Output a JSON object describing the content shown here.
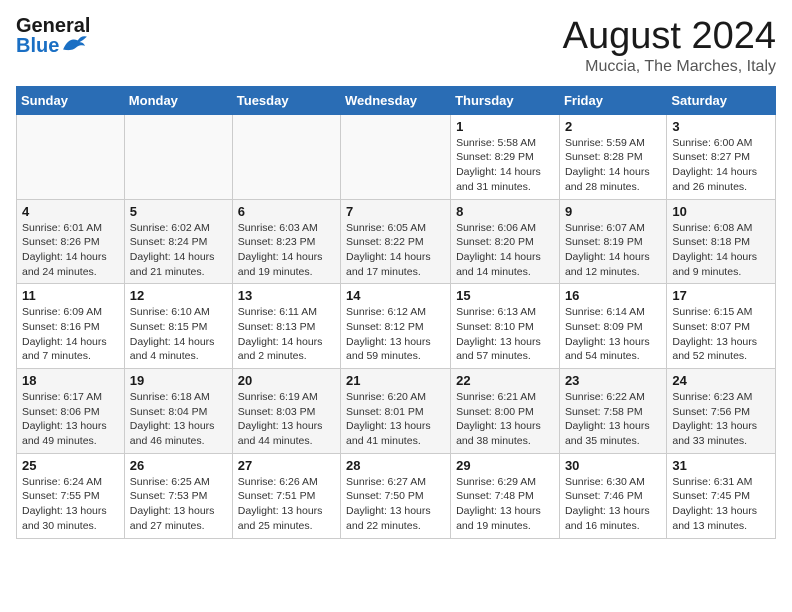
{
  "header": {
    "logo_general": "General",
    "logo_blue": "Blue",
    "month_title": "August 2024",
    "location": "Muccia, The Marches, Italy"
  },
  "days_of_week": [
    "Sunday",
    "Monday",
    "Tuesday",
    "Wednesday",
    "Thursday",
    "Friday",
    "Saturday"
  ],
  "weeks": [
    [
      {
        "day": "",
        "detail": ""
      },
      {
        "day": "",
        "detail": ""
      },
      {
        "day": "",
        "detail": ""
      },
      {
        "day": "",
        "detail": ""
      },
      {
        "day": "1",
        "detail": "Sunrise: 5:58 AM\nSunset: 8:29 PM\nDaylight: 14 hours\nand 31 minutes."
      },
      {
        "day": "2",
        "detail": "Sunrise: 5:59 AM\nSunset: 8:28 PM\nDaylight: 14 hours\nand 28 minutes."
      },
      {
        "day": "3",
        "detail": "Sunrise: 6:00 AM\nSunset: 8:27 PM\nDaylight: 14 hours\nand 26 minutes."
      }
    ],
    [
      {
        "day": "4",
        "detail": "Sunrise: 6:01 AM\nSunset: 8:26 PM\nDaylight: 14 hours\nand 24 minutes."
      },
      {
        "day": "5",
        "detail": "Sunrise: 6:02 AM\nSunset: 8:24 PM\nDaylight: 14 hours\nand 21 minutes."
      },
      {
        "day": "6",
        "detail": "Sunrise: 6:03 AM\nSunset: 8:23 PM\nDaylight: 14 hours\nand 19 minutes."
      },
      {
        "day": "7",
        "detail": "Sunrise: 6:05 AM\nSunset: 8:22 PM\nDaylight: 14 hours\nand 17 minutes."
      },
      {
        "day": "8",
        "detail": "Sunrise: 6:06 AM\nSunset: 8:20 PM\nDaylight: 14 hours\nand 14 minutes."
      },
      {
        "day": "9",
        "detail": "Sunrise: 6:07 AM\nSunset: 8:19 PM\nDaylight: 14 hours\nand 12 minutes."
      },
      {
        "day": "10",
        "detail": "Sunrise: 6:08 AM\nSunset: 8:18 PM\nDaylight: 14 hours\nand 9 minutes."
      }
    ],
    [
      {
        "day": "11",
        "detail": "Sunrise: 6:09 AM\nSunset: 8:16 PM\nDaylight: 14 hours\nand 7 minutes."
      },
      {
        "day": "12",
        "detail": "Sunrise: 6:10 AM\nSunset: 8:15 PM\nDaylight: 14 hours\nand 4 minutes."
      },
      {
        "day": "13",
        "detail": "Sunrise: 6:11 AM\nSunset: 8:13 PM\nDaylight: 14 hours\nand 2 minutes."
      },
      {
        "day": "14",
        "detail": "Sunrise: 6:12 AM\nSunset: 8:12 PM\nDaylight: 13 hours\nand 59 minutes."
      },
      {
        "day": "15",
        "detail": "Sunrise: 6:13 AM\nSunset: 8:10 PM\nDaylight: 13 hours\nand 57 minutes."
      },
      {
        "day": "16",
        "detail": "Sunrise: 6:14 AM\nSunset: 8:09 PM\nDaylight: 13 hours\nand 54 minutes."
      },
      {
        "day": "17",
        "detail": "Sunrise: 6:15 AM\nSunset: 8:07 PM\nDaylight: 13 hours\nand 52 minutes."
      }
    ],
    [
      {
        "day": "18",
        "detail": "Sunrise: 6:17 AM\nSunset: 8:06 PM\nDaylight: 13 hours\nand 49 minutes."
      },
      {
        "day": "19",
        "detail": "Sunrise: 6:18 AM\nSunset: 8:04 PM\nDaylight: 13 hours\nand 46 minutes."
      },
      {
        "day": "20",
        "detail": "Sunrise: 6:19 AM\nSunset: 8:03 PM\nDaylight: 13 hours\nand 44 minutes."
      },
      {
        "day": "21",
        "detail": "Sunrise: 6:20 AM\nSunset: 8:01 PM\nDaylight: 13 hours\nand 41 minutes."
      },
      {
        "day": "22",
        "detail": "Sunrise: 6:21 AM\nSunset: 8:00 PM\nDaylight: 13 hours\nand 38 minutes."
      },
      {
        "day": "23",
        "detail": "Sunrise: 6:22 AM\nSunset: 7:58 PM\nDaylight: 13 hours\nand 35 minutes."
      },
      {
        "day": "24",
        "detail": "Sunrise: 6:23 AM\nSunset: 7:56 PM\nDaylight: 13 hours\nand 33 minutes."
      }
    ],
    [
      {
        "day": "25",
        "detail": "Sunrise: 6:24 AM\nSunset: 7:55 PM\nDaylight: 13 hours\nand 30 minutes."
      },
      {
        "day": "26",
        "detail": "Sunrise: 6:25 AM\nSunset: 7:53 PM\nDaylight: 13 hours\nand 27 minutes."
      },
      {
        "day": "27",
        "detail": "Sunrise: 6:26 AM\nSunset: 7:51 PM\nDaylight: 13 hours\nand 25 minutes."
      },
      {
        "day": "28",
        "detail": "Sunrise: 6:27 AM\nSunset: 7:50 PM\nDaylight: 13 hours\nand 22 minutes."
      },
      {
        "day": "29",
        "detail": "Sunrise: 6:29 AM\nSunset: 7:48 PM\nDaylight: 13 hours\nand 19 minutes."
      },
      {
        "day": "30",
        "detail": "Sunrise: 6:30 AM\nSunset: 7:46 PM\nDaylight: 13 hours\nand 16 minutes."
      },
      {
        "day": "31",
        "detail": "Sunrise: 6:31 AM\nSunset: 7:45 PM\nDaylight: 13 hours\nand 13 minutes."
      }
    ]
  ]
}
